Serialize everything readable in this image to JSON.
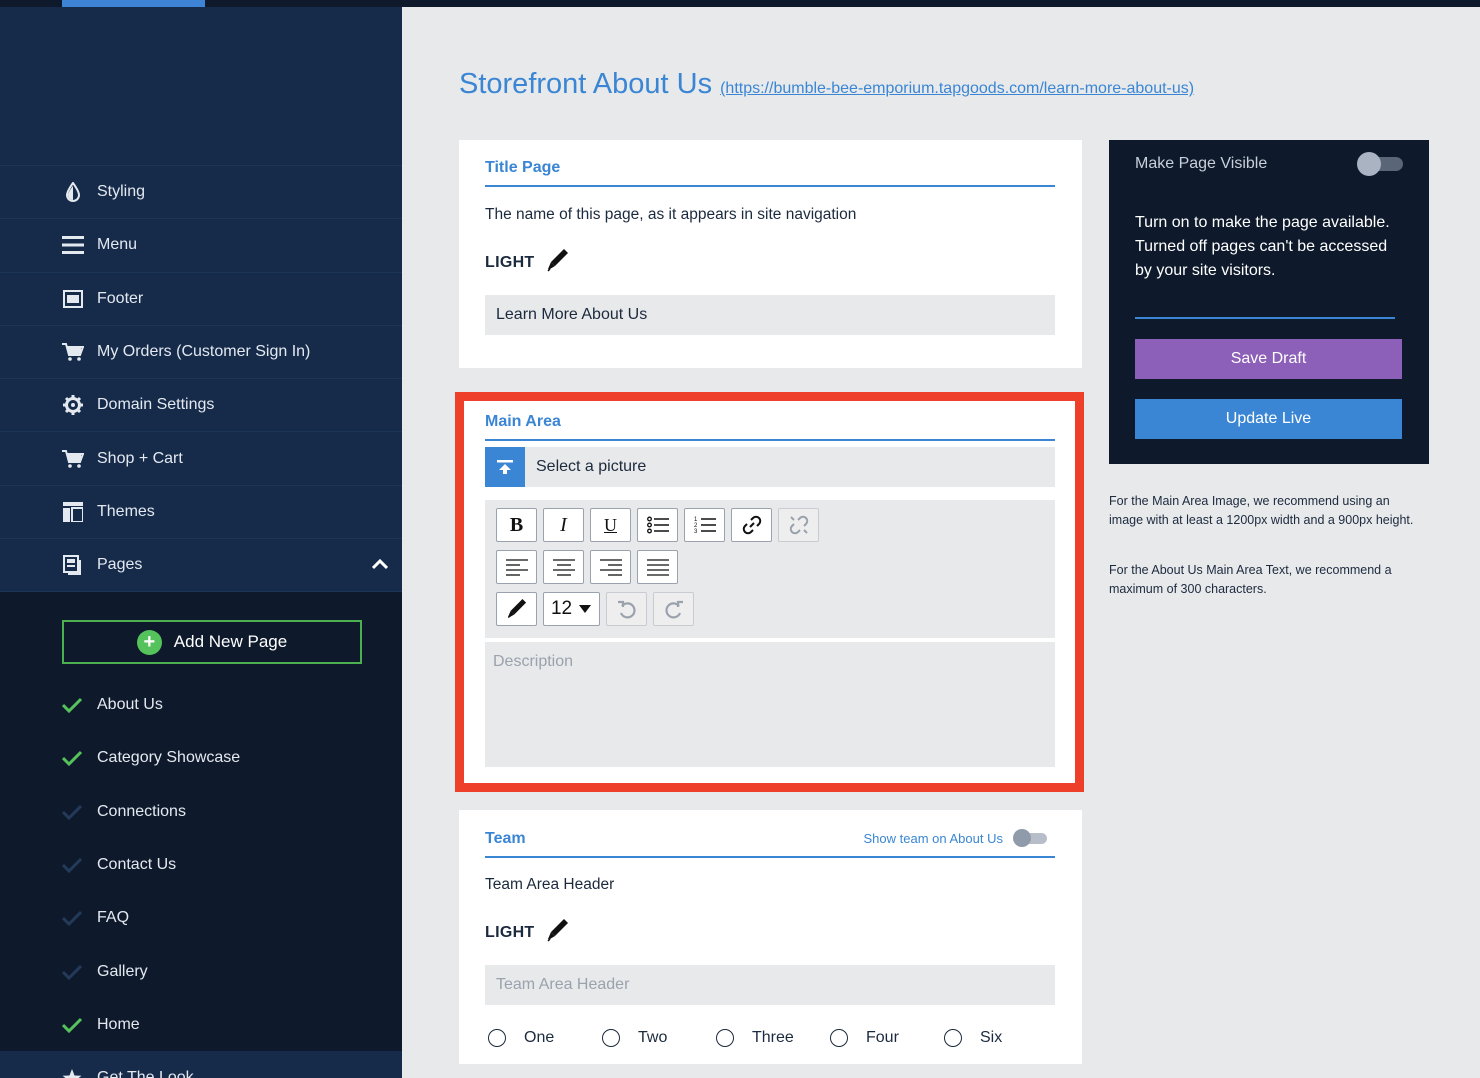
{
  "sidebar": {
    "nav_items": [
      {
        "label": "Styling",
        "icon": "droplet-icon"
      },
      {
        "label": "Menu",
        "icon": "hamburger-menu-icon"
      },
      {
        "label": "Footer",
        "icon": "footer-icon"
      },
      {
        "label": "My Orders (Customer Sign In)",
        "icon": "cart-icon"
      },
      {
        "label": "Domain Settings",
        "icon": "gear-icon"
      },
      {
        "label": "Shop + Cart",
        "icon": "cart-icon"
      },
      {
        "label": "Themes",
        "icon": "layout-icon"
      },
      {
        "label": "Pages",
        "icon": "pages-icon"
      }
    ],
    "add_page_label": "Add New Page",
    "pages": [
      {
        "label": "About Us",
        "active": true
      },
      {
        "label": "Category Showcase",
        "active": true
      },
      {
        "label": "Connections",
        "active": false
      },
      {
        "label": "Contact Us",
        "active": false
      },
      {
        "label": "FAQ",
        "active": false
      },
      {
        "label": "Gallery",
        "active": false
      },
      {
        "label": "Home",
        "active": true
      },
      {
        "label": "Get The Look",
        "active": false
      }
    ]
  },
  "header": {
    "title": "Storefront About Us",
    "url": "(https://bumble-bee-emporium.tapgoods.com/learn-more-about-us)"
  },
  "title_card": {
    "title": "Title Page",
    "help": "The name of this page, as it appears in site navigation",
    "theme_label": "LIGHT",
    "value": "Learn More About Us"
  },
  "main_area": {
    "title": "Main Area",
    "select_picture": "Select a picture",
    "font_size": "12",
    "description_placeholder": "Description"
  },
  "team_card": {
    "title": "Team",
    "show_toggle_label": "Show team on About Us",
    "help": "Team Area Header",
    "theme_label": "LIGHT",
    "header_placeholder": "Team Area Header",
    "options": [
      "One",
      "Two",
      "Three",
      "Four",
      "Six"
    ]
  },
  "visibility_panel": {
    "toggle_label": "Make Page Visible",
    "info": "Turn on to make the page available. Turned off pages can't be accessed by your site visitors.",
    "save_draft": "Save Draft",
    "update_live": "Update Live"
  },
  "recommendations": {
    "image": "For the Main Area Image, we recommend using an image with at least a 1200px width and a 900px height.",
    "text": "For the About Us Main Area Text, we recommend a maximum of 300 characters."
  },
  "colors": {
    "accent": "#3a86d4",
    "sidebar": "#162b4a",
    "sidebar_dark": "#0e1a2b",
    "draft": "#8c5fb8",
    "success": "#56c25b",
    "highlight": "#ee3f2a"
  }
}
